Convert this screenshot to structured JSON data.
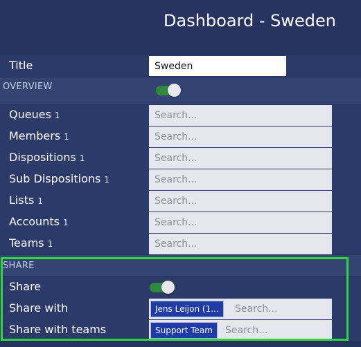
{
  "header": {
    "title": "Dashboard - Sweden"
  },
  "title_row": {
    "label": "Title",
    "value": "Sweden"
  },
  "overview": {
    "section_label": "OVERVIEW",
    "toggle_on": true,
    "rows": [
      {
        "label": "Queues",
        "count": "1",
        "placeholder": "Search..."
      },
      {
        "label": "Members",
        "count": "1",
        "placeholder": "Search..."
      },
      {
        "label": "Dispositions",
        "count": "1",
        "placeholder": "Search..."
      },
      {
        "label": "Sub Dispositions",
        "count": "1",
        "placeholder": "Search..."
      },
      {
        "label": "Lists",
        "count": "1",
        "placeholder": "Search..."
      },
      {
        "label": "Accounts",
        "count": "1",
        "placeholder": "Search..."
      },
      {
        "label": "Teams",
        "count": "1",
        "placeholder": "Search..."
      }
    ]
  },
  "share": {
    "section_label": "SHARE",
    "share_label": "Share",
    "share_toggle_on": true,
    "share_with": {
      "label": "Share with",
      "chip": "Jens Leijon (1...",
      "placeholder": "Search..."
    },
    "share_with_teams": {
      "label": "Share with teams",
      "chip": "Support Team",
      "placeholder": "Search..."
    }
  },
  "colors": {
    "background": "#27335e",
    "toggle_on": "#2f8a3e",
    "chip": "#1f3ca6",
    "highlight": "#2bd93c"
  }
}
